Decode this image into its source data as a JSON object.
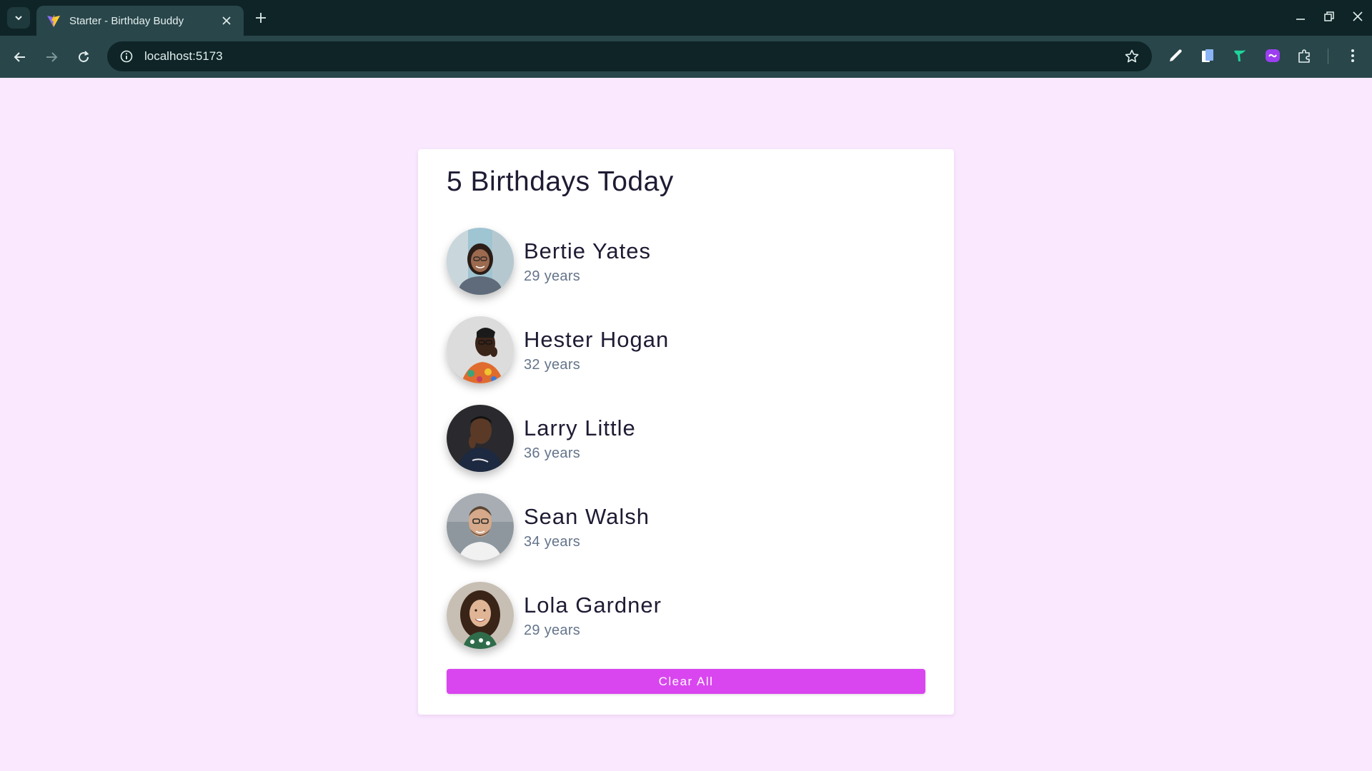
{
  "browser": {
    "tab_title": "Starter - Birthday Buddy",
    "url": "localhost:5173",
    "icons": {
      "tab_search": "chevron-down-icon",
      "favicon": "vite-icon",
      "close": "close-icon",
      "new_tab": "plus-icon",
      "minimize": "minimize-icon",
      "restore": "restore-icon",
      "window_close": "close-icon",
      "back": "arrow-left-icon",
      "forward": "arrow-right-icon",
      "reload": "reload-icon",
      "site_info": "info-icon",
      "bookmark": "star-icon",
      "extensions": [
        "eyedropper-icon",
        "pages-icon",
        "bird-icon",
        "purple-link-icon",
        "puzzle-icon"
      ],
      "menu": "kebab-menu-icon"
    }
  },
  "page": {
    "title": "5 Birthdays Today",
    "people": [
      {
        "name": "Bertie Yates",
        "age": "29 years"
      },
      {
        "name": "Hester Hogan",
        "age": "32 years"
      },
      {
        "name": "Larry Little",
        "age": "36 years"
      },
      {
        "name": "Sean Walsh",
        "age": "34 years"
      },
      {
        "name": "Lola Gardner",
        "age": "29 years"
      }
    ],
    "clear_label": "Clear All"
  },
  "colors": {
    "page_bg": "#fae8ff",
    "card_bg": "#ffffff",
    "button_bg": "#d946ef",
    "chrome_dark": "#0e2426",
    "chrome_toolbar": "#29464a"
  }
}
